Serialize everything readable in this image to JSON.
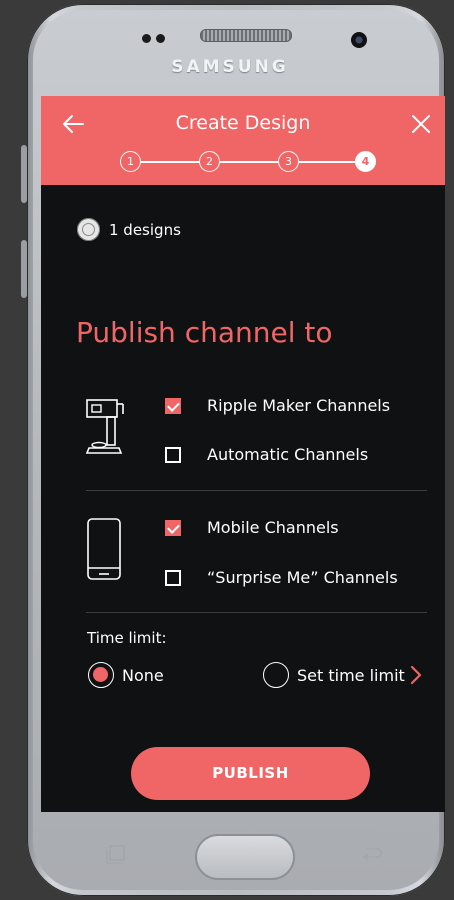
{
  "device": {
    "brand": "SAMSUNG"
  },
  "appbar": {
    "title": "Create Design",
    "steps": [
      "1",
      "2",
      "3",
      "4"
    ],
    "active_step": 4
  },
  "summary": {
    "designs_label": "1 designs"
  },
  "publish": {
    "title": "Publish channel to",
    "groups": [
      {
        "device": "ripple-maker-icon",
        "options": [
          {
            "label": "Ripple Maker Channels",
            "checked": true
          },
          {
            "label": "Automatic Channels",
            "checked": false
          }
        ]
      },
      {
        "device": "mobile-phone-icon",
        "options": [
          {
            "label": "Mobile Channels",
            "checked": true
          },
          {
            "label": "“Surprise Me” Channels",
            "checked": false
          }
        ]
      }
    ]
  },
  "time_limit": {
    "label": "Time limit:",
    "options": [
      {
        "label": "None",
        "selected": true
      },
      {
        "label": "Set time limit",
        "selected": false
      }
    ]
  },
  "actions": {
    "publish_label": "PUBLISH"
  },
  "colors": {
    "accent": "#f06565",
    "background": "#101113",
    "text": "#ffffff"
  },
  "icons": {
    "back": "arrow-left-icon",
    "close": "close-icon",
    "designs": "coffee-cup-icon",
    "more": "chevron-right-icon"
  }
}
